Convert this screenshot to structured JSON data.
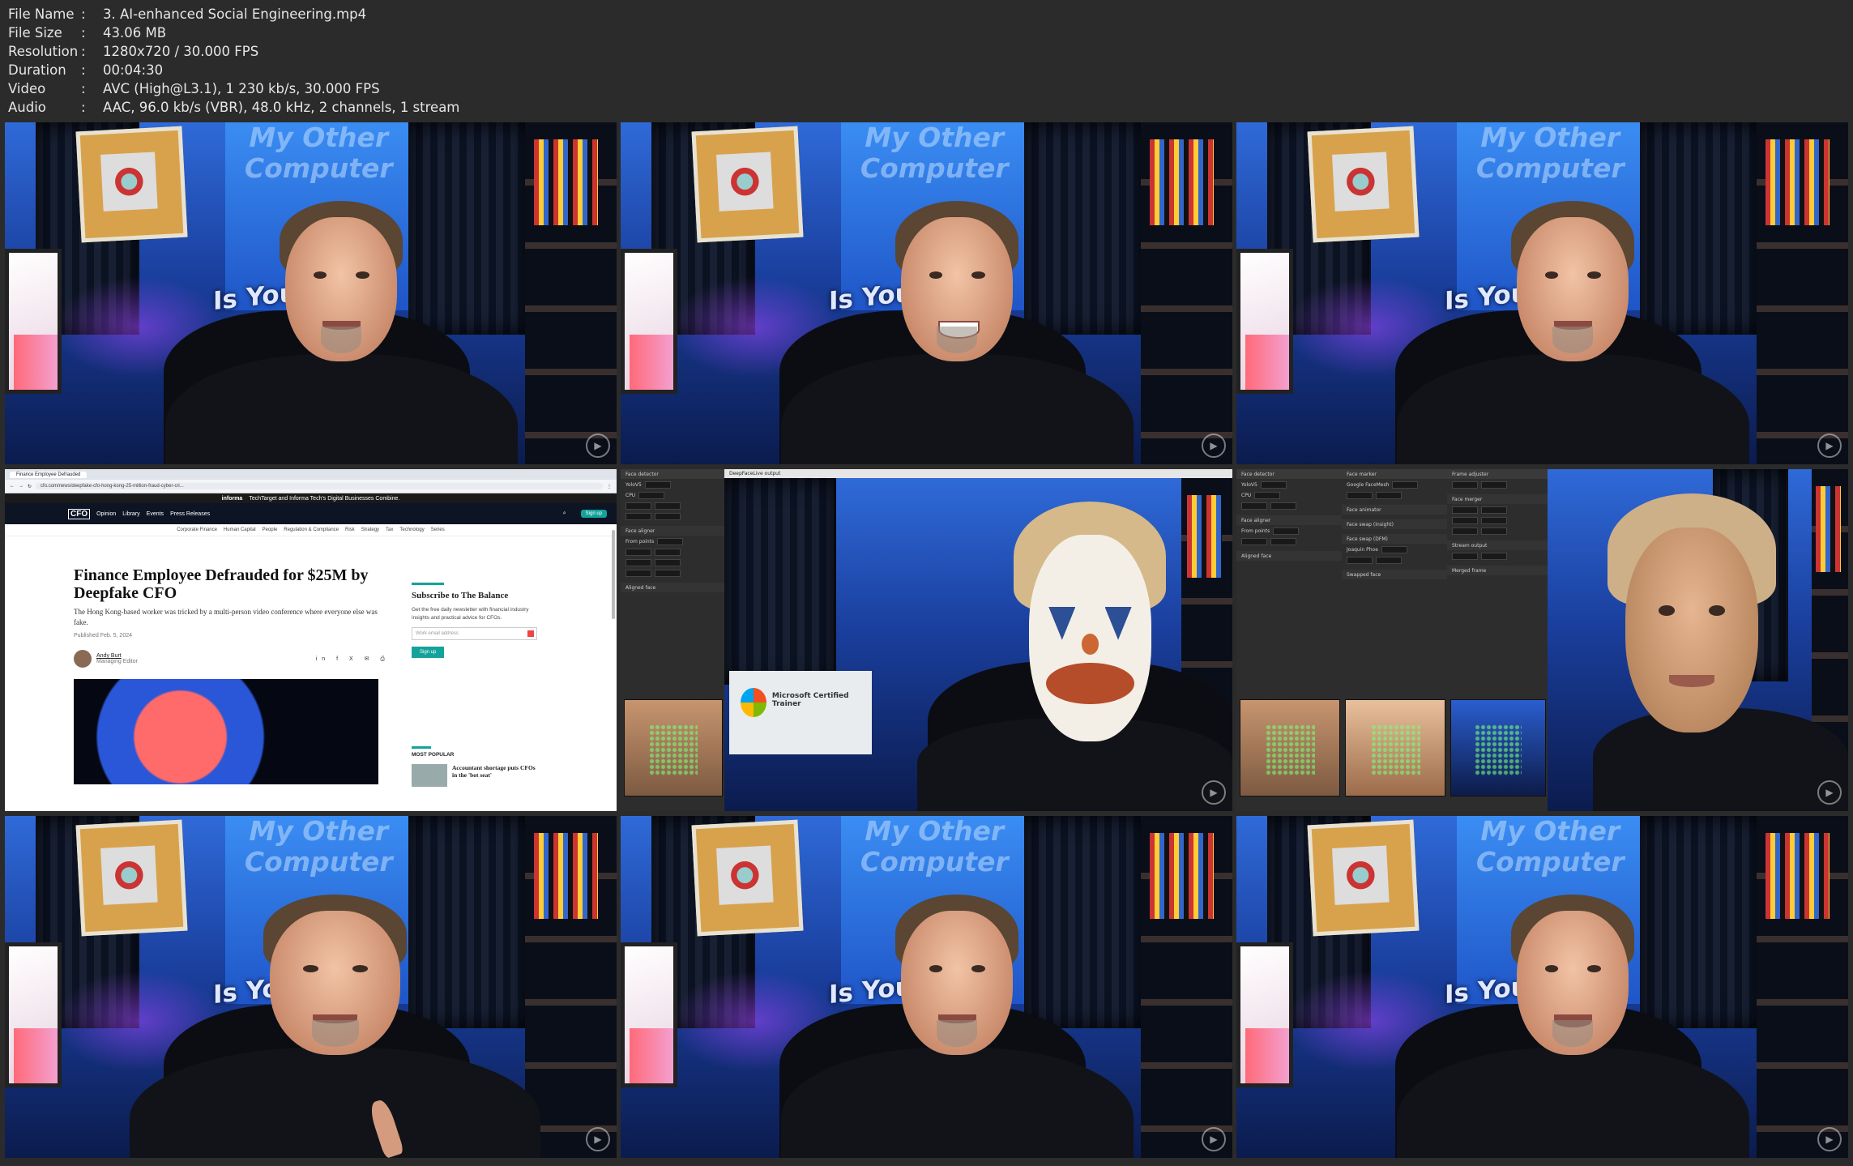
{
  "info": [
    {
      "key": "File Name",
      "value": "3. AI-enhanced Social Engineering.mp4"
    },
    {
      "key": "File Size",
      "value": "43.06 MB"
    },
    {
      "key": "Resolution",
      "value": "1280x720 / 30.000 FPS"
    },
    {
      "key": "Duration",
      "value": "00:04:30"
    },
    {
      "key": "Video",
      "value": "AVC (High@L3.1), 1 230 kb/s, 30.000 FPS"
    },
    {
      "key": "Audio",
      "value": "AAC, 96.0 kb/s (VBR), 48.0 kHz, 2 channels, 1 stream"
    }
  ],
  "info_sep": ":",
  "studio": {
    "banner_line1": "My Other",
    "banner_line2": "Computer",
    "banner_main": "Is Your Co",
    "watermark_icon": "play-circle-icon"
  },
  "browser": {
    "tab": "Finance Employee Defrauded",
    "url": "cfo.com/news/deepfake-cfo-hong-kong-25-million-fraud-cyber-cri...",
    "informa": "informa",
    "informa_note": "TechTarget and Informa Tech's Digital Businesses Combine.",
    "logo": "CFO",
    "nav": [
      "Opinion",
      "Library",
      "Events",
      "Press Releases"
    ],
    "sign_up": "Sign up",
    "subnav": [
      "Corporate Finance",
      "Human Capital",
      "People",
      "Regulation & Compliance",
      "Risk",
      "Strategy",
      "Tax",
      "Technology",
      "Series"
    ],
    "title": "Finance Employee Defrauded for $25M by Deepfake CFO",
    "dek": "The Hong Kong-based worker was tricked by a multi-person video conference where everyone else was fake.",
    "date": "Published Feb. 5, 2024",
    "author": "Andy Burt",
    "author_role": "Managing Editor",
    "side_title": "Subscribe to The Balance",
    "side_text": "Get the free daily newsletter with financial industry insights and practical advice for CFOs.",
    "side_placeholder": "Work email address",
    "side_button": "Sign up",
    "popular_hd": "MOST POPULAR",
    "popular_item": "Accountant shortage puts CFOs in the 'bot seat'"
  },
  "deepface": {
    "window_title": "DeepFaceLive output",
    "panels": {
      "face_detector": "Face detector",
      "face_aligner": "Face aligner",
      "face_marker": "Face marker",
      "face_animator": "Face animator",
      "face_swap_insight": "Face swap (Insight)",
      "face_swap_dfm": "Face swap (DFM)",
      "frame_adjuster": "Frame adjuster",
      "face_merger": "Face merger",
      "stream_output": "Stream output",
      "aligned_face": "Aligned face",
      "swapped_face": "Swapped face",
      "merged_frame": "Merged frame",
      "detector_value": "YoloV5",
      "device_value": "CPU",
      "mode_value": "From points",
      "marker_value": "Google FaceMesh",
      "model_value": "Joaquin Phoe",
      "ms_cert": "Microsoft Certified Trainer"
    }
  }
}
